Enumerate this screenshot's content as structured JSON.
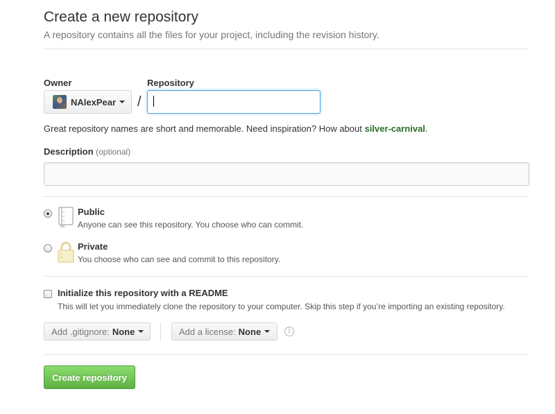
{
  "header": {
    "title": "Create a new repository",
    "subtitle": "A repository contains all the files for your project, including the revision history."
  },
  "owner": {
    "label": "Owner",
    "selected": "NAlexPear",
    "avatar_icon": "user-avatar"
  },
  "repo_name": {
    "label": "Repository name",
    "value": "",
    "separator": "/"
  },
  "hint": {
    "text": "Great repository names are short and memorable. Need inspiration? How about ",
    "suggestion": "silver-carnival",
    "end": "."
  },
  "description": {
    "label": "Description",
    "optional": "(optional)",
    "value": ""
  },
  "visibility": {
    "selected": "public",
    "public": {
      "title": "Public",
      "desc": "Anyone can see this repository. You choose who can commit.",
      "icon": "book-icon"
    },
    "private": {
      "title": "Private",
      "desc": "You choose who can see and commit to this repository.",
      "icon": "lock-icon"
    }
  },
  "readme": {
    "checked": false,
    "title": "Initialize this repository with a README",
    "desc": "This will let you immediately clone the repository to your computer. Skip this step if you’re importing an existing repository."
  },
  "gitignore": {
    "label": "Add .gitignore:",
    "value": "None"
  },
  "license": {
    "label": "Add a license:",
    "value": "None",
    "info_icon": "info-icon"
  },
  "submit": {
    "label": "Create repository"
  },
  "colors": {
    "accent_green": "#60b044",
    "suggestion_green": "#2a6f2a",
    "focus_blue": "#51a7e8",
    "lock_yellow": "#f0e0a0"
  }
}
